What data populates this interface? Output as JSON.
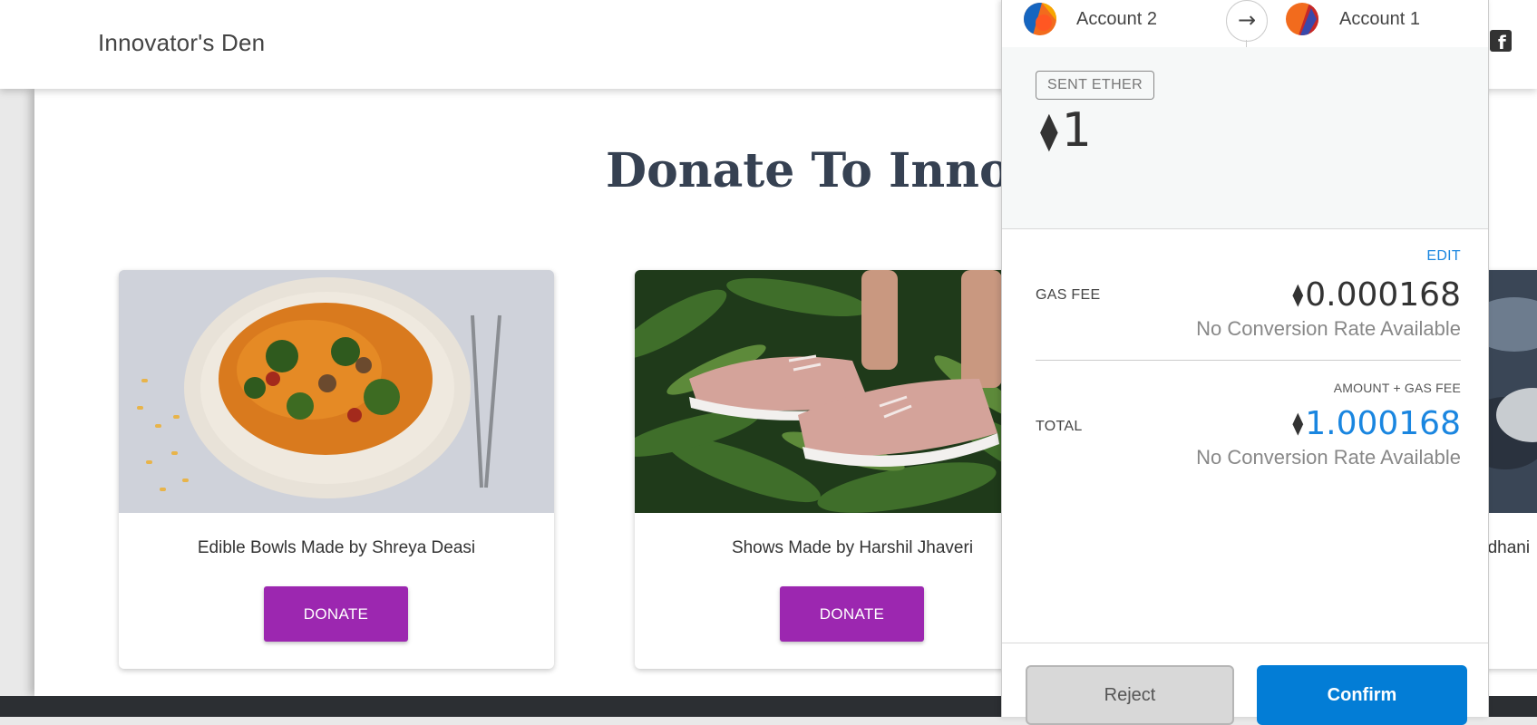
{
  "site": {
    "brand": "Innovator's Den",
    "heading": "Donate To Innova",
    "cards": [
      {
        "title": "Edible Bowls Made by Shreya Deasi",
        "button": "DONATE"
      },
      {
        "title": "Shows Made by Harshil Jhaveri",
        "button": "DONATE"
      },
      {
        "title": "adhani"
      }
    ]
  },
  "metamask": {
    "from_account": "Account 2",
    "to_account": "Account 1",
    "sent_label": "SENT ETHER",
    "amount": "1",
    "edit_label": "EDIT",
    "gas_fee_label": "GAS FEE",
    "gas_fee_value": "0.000168",
    "gas_fee_conversion": "No Conversion Rate Available",
    "amount_gas_caption": "AMOUNT + GAS FEE",
    "total_label": "TOTAL",
    "total_value": "1.000168",
    "total_conversion": "No Conversion Rate Available",
    "reject_label": "Reject",
    "confirm_label": "Confirm",
    "accent_color": "#037dd6"
  }
}
